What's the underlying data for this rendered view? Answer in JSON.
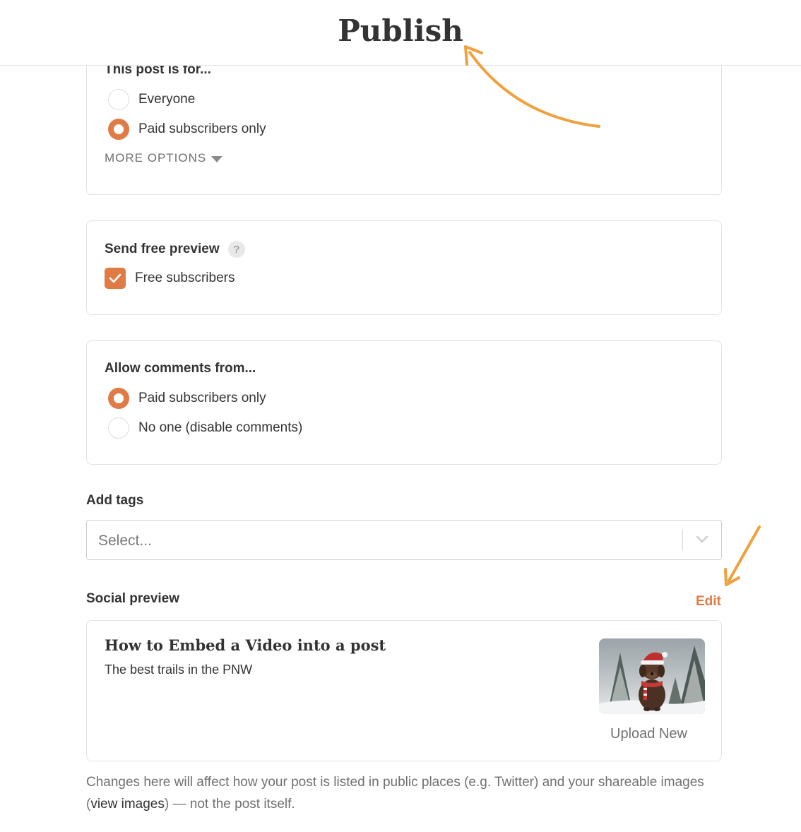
{
  "header": {
    "title": "Publish"
  },
  "audience": {
    "title": "This post is for...",
    "options": [
      {
        "label": "Everyone",
        "selected": false
      },
      {
        "label": "Paid subscribers only",
        "selected": true
      }
    ],
    "more_options": "MORE OPTIONS"
  },
  "free_preview": {
    "title": "Send free preview",
    "help": "?",
    "checkbox_label": "Free subscribers",
    "checked": true
  },
  "comments": {
    "title": "Allow comments from...",
    "options": [
      {
        "label": "Paid subscribers only",
        "selected": true
      },
      {
        "label": "No one (disable comments)",
        "selected": false
      }
    ]
  },
  "tags": {
    "label": "Add tags",
    "placeholder": "Select..."
  },
  "social_preview": {
    "label": "Social preview",
    "edit": "Edit",
    "post_title": "How to Embed a Video into a post",
    "post_subtitle": "The best trails in the PNW",
    "upload": "Upload New",
    "note_before": "Changes here will affect how your post is listed in public places (e.g. Twitter) and your shareable images (",
    "note_link": "view images",
    "note_after": ") — not the post itself."
  },
  "colors": {
    "accent": "#e07b45",
    "annotation_arrow": "#f0a03c"
  }
}
